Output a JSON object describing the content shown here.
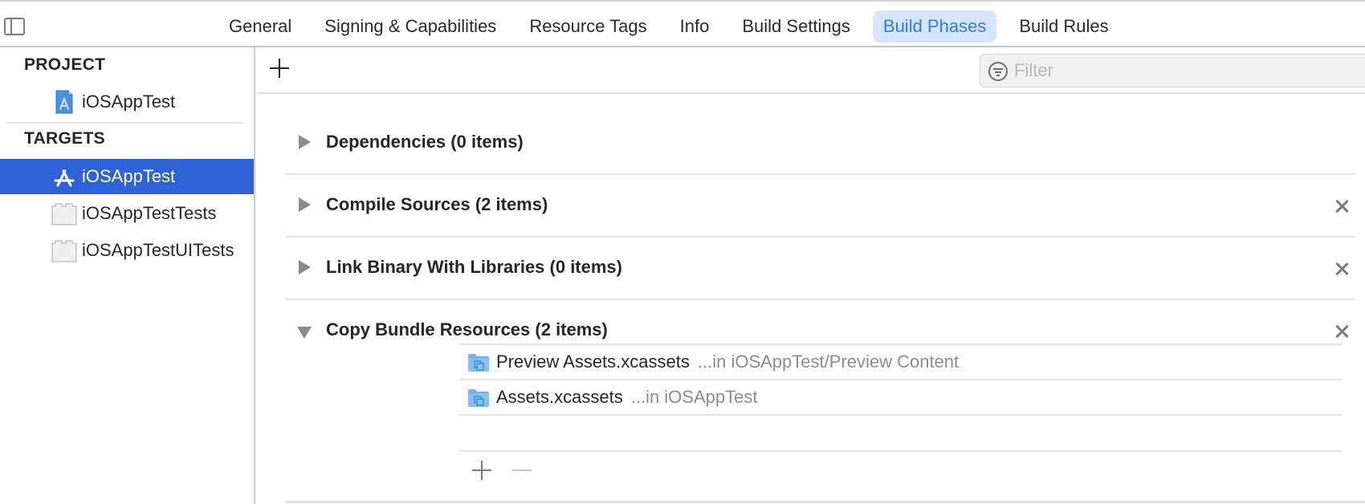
{
  "tabs": [
    {
      "label": "General",
      "active": false
    },
    {
      "label": "Signing & Capabilities",
      "active": false
    },
    {
      "label": "Resource Tags",
      "active": false
    },
    {
      "label": "Info",
      "active": false
    },
    {
      "label": "Build Settings",
      "active": false
    },
    {
      "label": "Build Phases",
      "active": true
    },
    {
      "label": "Build Rules",
      "active": false
    }
  ],
  "sidebar": {
    "project_header": "PROJECT",
    "project_item": {
      "label": "iOSAppTest",
      "icon": "xcode-project-icon"
    },
    "targets_header": "TARGETS",
    "targets": [
      {
        "label": "iOSAppTest",
        "icon": "app-target-icon",
        "selected": true
      },
      {
        "label": "iOSAppTestTests",
        "icon": "test-bundle-icon",
        "selected": false
      },
      {
        "label": "iOSAppTestUITests",
        "icon": "test-bundle-icon",
        "selected": false
      }
    ]
  },
  "toolbar": {
    "filter_placeholder": "Filter",
    "filter_value": ""
  },
  "phases": [
    {
      "title": "Dependencies (0 items)",
      "expanded": false,
      "removable": false
    },
    {
      "title": "Compile Sources (2 items)",
      "expanded": false,
      "removable": true
    },
    {
      "title": "Link Binary With Libraries (0 items)",
      "expanded": false,
      "removable": true
    },
    {
      "title": "Copy Bundle Resources (2 items)",
      "expanded": true,
      "removable": true
    }
  ],
  "resources": [
    {
      "name": "Preview Assets.xcassets",
      "location": "...in iOSAppTest/Preview Content",
      "icon": "asset-folder-icon"
    },
    {
      "name": "Assets.xcassets",
      "location": "...in iOSAppTest",
      "icon": "asset-folder-icon"
    }
  ],
  "colors": {
    "accent": "#3478f6",
    "selection": "#2d63d6",
    "active_tab_bg": "#d5e5fb"
  }
}
